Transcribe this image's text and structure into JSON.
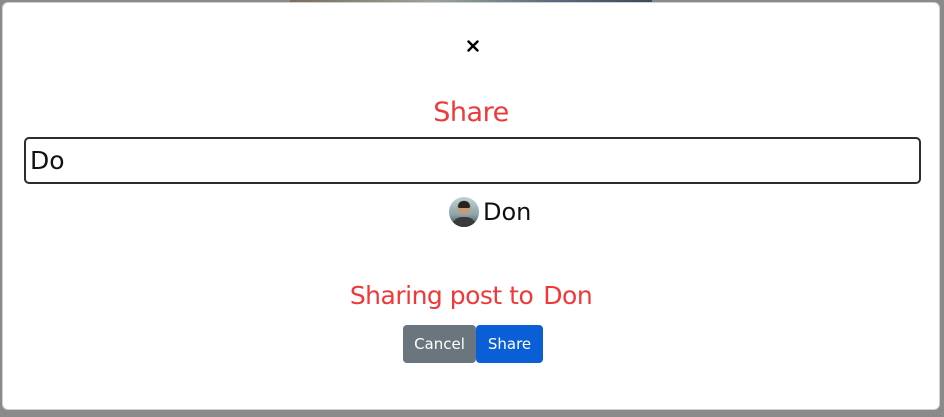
{
  "modal": {
    "close_icon": "close-icon",
    "title": "Share",
    "search": {
      "value": "Do",
      "placeholder": ""
    },
    "results": [
      {
        "name": "Don",
        "avatar_icon": "user-avatar"
      }
    ],
    "status": {
      "prefix": "Sharing post to",
      "recipient": "Don"
    },
    "buttons": {
      "cancel_label": "Cancel",
      "share_label": "Share"
    }
  },
  "colors": {
    "accent_red": "#f0383a",
    "cancel_gray": "#6b757d",
    "share_blue": "#0b5fd6"
  }
}
